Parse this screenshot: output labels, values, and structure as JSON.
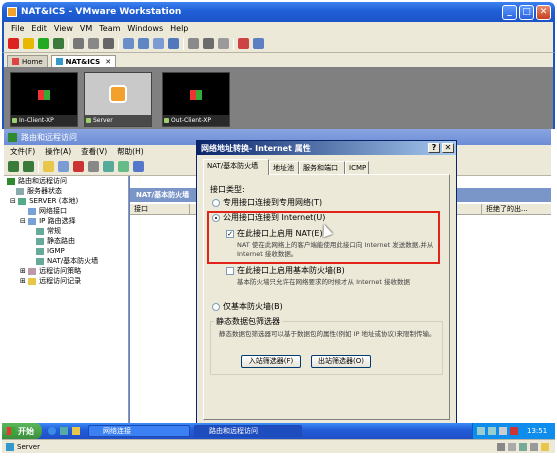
{
  "vmware": {
    "title": "NAT&ICS - VMware Workstation",
    "menu": [
      "File",
      "Edit",
      "View",
      "VM",
      "Team",
      "Windows",
      "Help"
    ],
    "tabs": [
      "Home",
      "NAT&ICS"
    ],
    "thumbs": [
      "In-Client-XP",
      "Server",
      "Out-Client-XP"
    ],
    "status": "Server"
  },
  "rras": {
    "title": "路由和远程访问",
    "menu": [
      "文件(F)",
      "操作(A)",
      "查看(V)",
      "帮助(H)"
    ],
    "tree": [
      "路由和远程访问",
      "服务器状态",
      "SERVER (本地)",
      "网络接口",
      "IP 路由选择",
      "常规",
      "静态路由",
      "IGMP",
      "NAT/基本防火墙",
      "远程访问策略",
      "远程访问记录"
    ],
    "pane_title": "NAT/基本防火墙",
    "col_interface": "接口",
    "col_rejected": "拒绝了的出..."
  },
  "dialog": {
    "title": "网络地址转换- Internet 属性",
    "tabs": [
      "NAT/基本防火墙",
      "地址池",
      "服务和端口",
      "ICMP"
    ],
    "interface_type": "接口类型:",
    "opt_private": "专用接口连接到专用网络(T)",
    "opt_public": "公用接口连接到 Internet(U)",
    "chk_nat": "在此接口上启用 NAT(E)",
    "nat_desc": "NAT 使在此网络上的客户端能使用此接口向 Internet 发送数据,并从 Internet 接收数据。",
    "chk_fw": "在此接口上启用基本防火墙(B)",
    "fw_desc": "基本防火墙只允许在网络要求的时候才从 Internet 接收数据",
    "opt_fw_only": "仅基本防火墙(B)",
    "group_title": "静态数据包筛选器",
    "group_desc": "静态数据包筛选器可以基于数据包的属性(例如 IP 地址或协议)来限制传输。",
    "btn_in": "入站筛选器(F)",
    "btn_out": "出站筛选器(O)"
  },
  "taskbar": {
    "start": "开始",
    "tasks": [
      "网络连接",
      "路由和远程访问"
    ],
    "time": "13:51"
  }
}
